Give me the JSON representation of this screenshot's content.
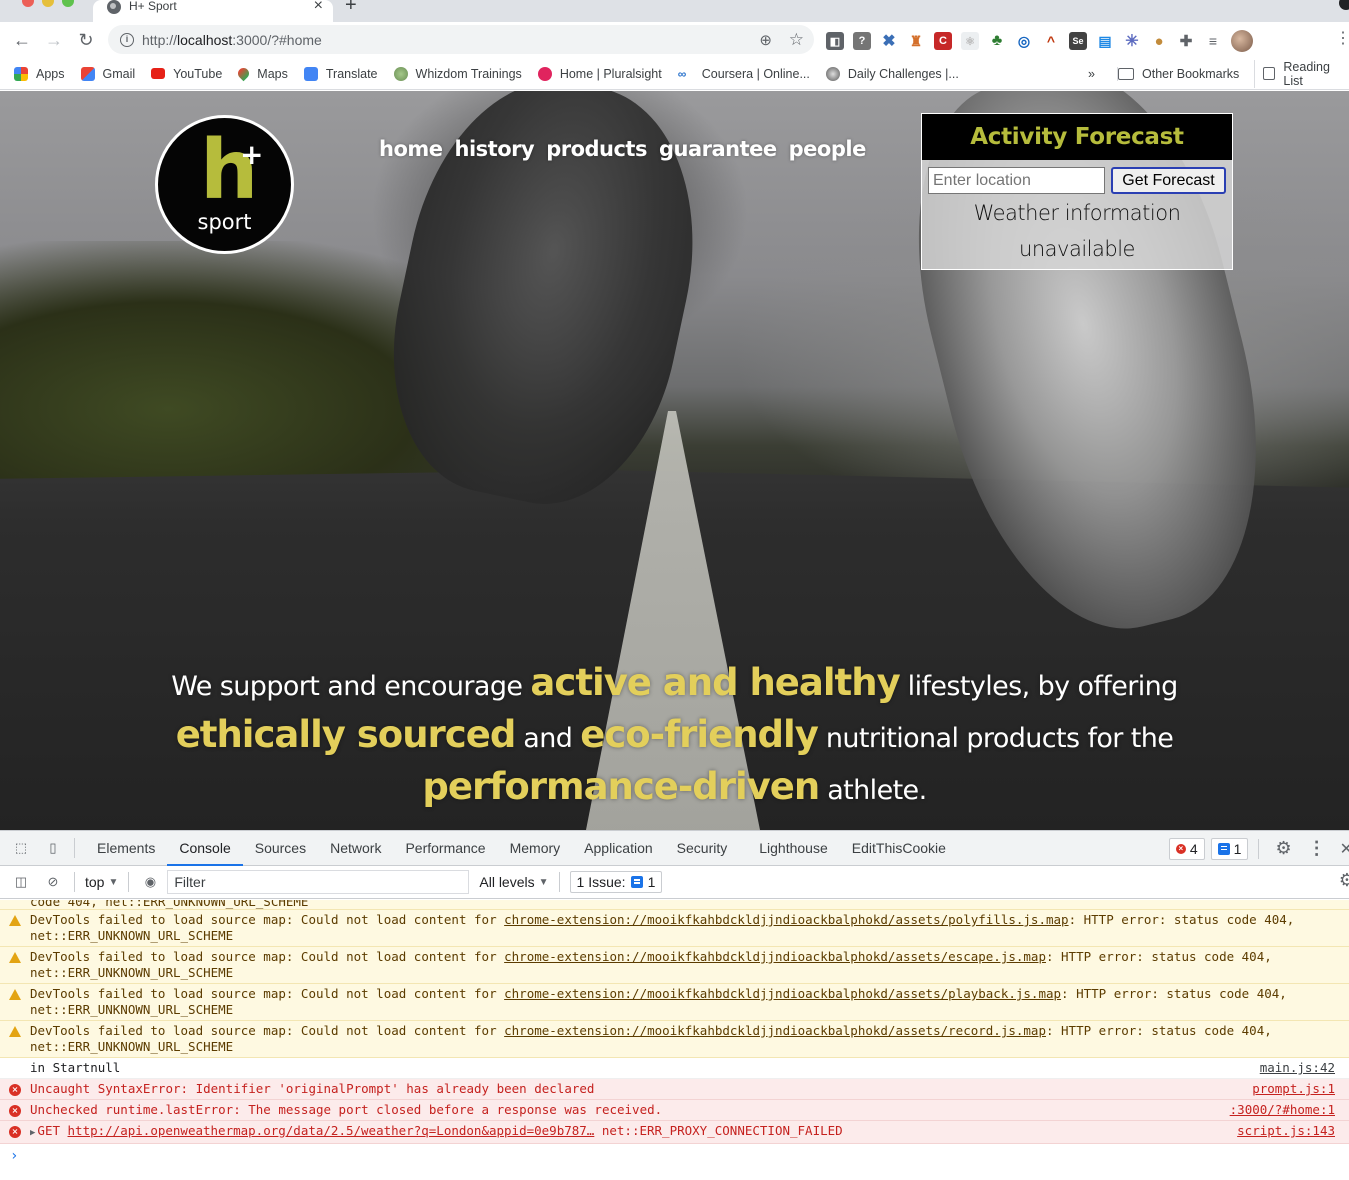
{
  "browser": {
    "tab_title": "H+ Sport",
    "url_prefix": "http://",
    "url_host": "localhost",
    "url_rest": ":3000/?#home",
    "bookmarks": [
      {
        "label": "Apps",
        "icon": "apps-grid-icon"
      },
      {
        "label": "Gmail",
        "icon": "gmail-icon"
      },
      {
        "label": "YouTube",
        "icon": "youtube-icon"
      },
      {
        "label": "Maps",
        "icon": "maps-pin-icon"
      },
      {
        "label": "Translate",
        "icon": "translate-icon"
      },
      {
        "label": "Whizdom Trainings",
        "icon": "tree-icon"
      },
      {
        "label": "Home | Pluralsight",
        "icon": "pluralsight-icon"
      },
      {
        "label": "Coursera | Online...",
        "icon": "coursera-icon"
      },
      {
        "label": "Daily Challenges |...",
        "icon": "soccer-ball-icon"
      }
    ],
    "bookmarks_overflow": "»",
    "other_bookmarks": "Other Bookmarks",
    "reading_list": "Reading List"
  },
  "site": {
    "logo_letter": "h",
    "logo_plus": "+",
    "logo_word": "sport",
    "nav": [
      "home",
      "history",
      "products",
      "guarantee",
      "people"
    ],
    "forecast": {
      "title": "Activity Forecast",
      "input_placeholder": "Enter location",
      "input_value": "",
      "button_label": "Get Forecast",
      "message_line1": "Weather information",
      "message_line2": "unavailable"
    },
    "tagline": [
      {
        "text": "We support and encourage ",
        "highlight": false
      },
      {
        "text": "active and healthy",
        "highlight": true
      },
      {
        "text": " lifestyles, by offering ",
        "highlight": false
      },
      {
        "text": "ethically sourced",
        "highlight": true
      },
      {
        "text": " and ",
        "highlight": false
      },
      {
        "text": "eco-friendly",
        "highlight": true
      },
      {
        "text": " nutritional products for the ",
        "highlight": false
      },
      {
        "text": "performance-driven",
        "highlight": true
      },
      {
        "text": " athlete.",
        "highlight": false
      }
    ],
    "colors": {
      "brand_green": "#b6bc3c",
      "highlight_yellow": "#e3cf5b"
    }
  },
  "devtools": {
    "tabs": [
      "Elements",
      "Console",
      "Sources",
      "Network",
      "Performance",
      "Memory",
      "Application",
      "Security",
      "Lighthouse",
      "EditThisCookie"
    ],
    "active_tab": "Console",
    "error_count": "4",
    "message_count": "1",
    "context": "top",
    "filter_placeholder": "Filter",
    "levels": "All levels",
    "issues_label": "1 Issue:",
    "issues_count": "1",
    "console": [
      {
        "level": "warn",
        "prefix": "DevTools failed to load source map: Could not load content for ",
        "link": "chrome-extension://mooikfkahbdckldjjndioackbalphokd/assets/polyfills.js.map",
        "suffix": ": HTTP error: status code 404, net::ERR_UNKNOWN_URL_SCHEME"
      },
      {
        "level": "warn",
        "prefix": "DevTools failed to load source map: Could not load content for ",
        "link": "chrome-extension://mooikfkahbdckldjjndioackbalphokd/assets/escape.js.map",
        "suffix": ": HTTP error: status code 404, net::ERR_UNKNOWN_URL_SCHEME"
      },
      {
        "level": "warn",
        "prefix": "DevTools failed to load source map: Could not load content for ",
        "link": "chrome-extension://mooikfkahbdckldjjndioackbalphokd/assets/playback.js.map",
        "suffix": ": HTTP error: status code 404, net::ERR_UNKNOWN_URL_SCHEME"
      },
      {
        "level": "warn",
        "prefix": "DevTools failed to load source map: Could not load content for ",
        "link": "chrome-extension://mooikfkahbdckldjjndioackbalphokd/assets/record.js.map",
        "suffix": ": HTTP error: status code 404, net::ERR_UNKNOWN_URL_SCHEME"
      },
      {
        "level": "log",
        "text": "in Startnull",
        "source": "main.js:42"
      },
      {
        "level": "error",
        "text": "Uncaught SyntaxError: Identifier 'originalPrompt' has already been declared",
        "source": "prompt.js:1"
      },
      {
        "level": "error",
        "text": "Unchecked runtime.lastError: The message port closed before a response was received.",
        "source": ":3000/?#home:1"
      },
      {
        "level": "error",
        "method": "GET",
        "link": "http://api.openweathermap.org/data/2.5/weather?q=London&appid=0e9b787…",
        "suffix": " net::ERR_PROXY_CONNECTION_FAILED",
        "source": "script.js:143"
      }
    ],
    "prompt_symbol": "›"
  }
}
